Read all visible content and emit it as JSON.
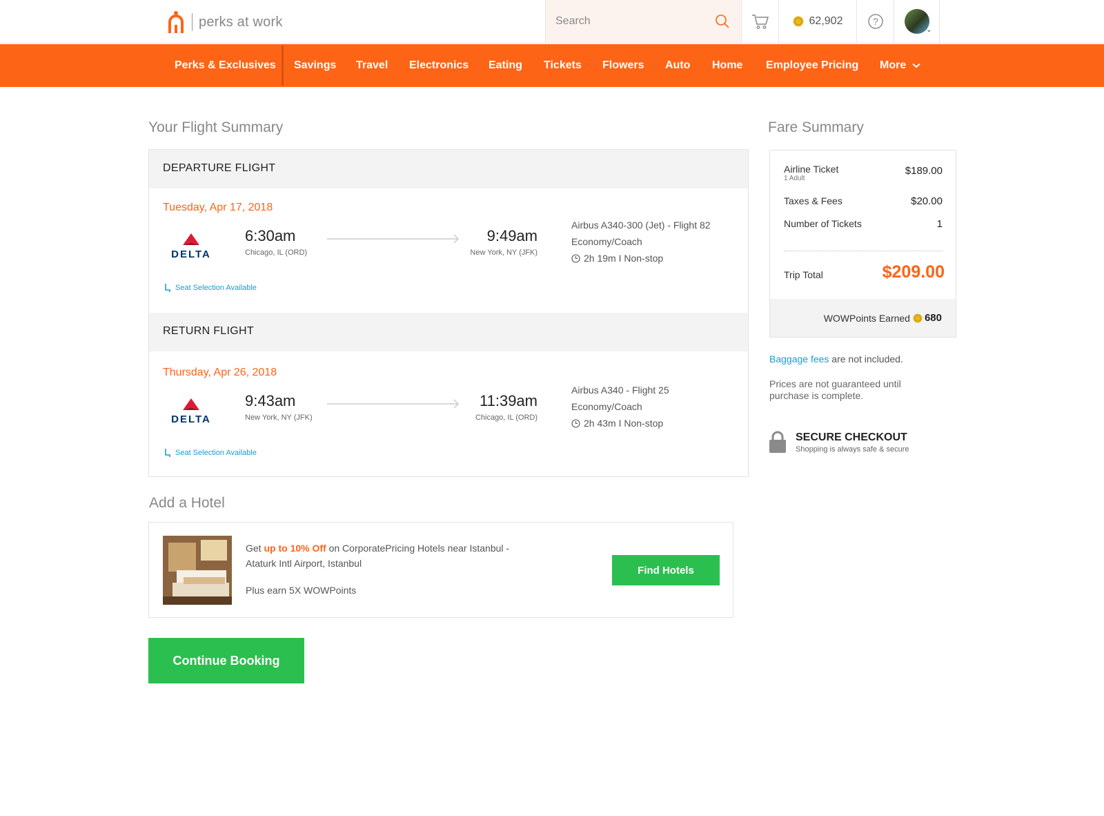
{
  "header": {
    "logo_text": "perks at work",
    "search_placeholder": "Search",
    "points": "62,902"
  },
  "nav": {
    "items": [
      "Perks & Exclusives",
      "Savings",
      "Travel",
      "Electronics",
      "Eating",
      "Tickets",
      "Flowers",
      "Auto",
      "Home",
      "Employee Pricing",
      "More"
    ]
  },
  "flight_summary": {
    "title": "Your Flight Summary",
    "departure": {
      "header": "DEPARTURE FLIGHT",
      "date": "Tuesday, Apr 17, 2018",
      "airline": "DELTA",
      "depart_time": "6:30am",
      "depart_city": "Chicago, IL (ORD)",
      "arrive_time": "9:49am",
      "arrive_city": "New York, NY (JFK)",
      "aircraft": "Airbus A340-300 (Jet) - Flight 82",
      "cabin": "Economy/Coach",
      "duration": "2h 19m  I  Non-stop",
      "seat": "Seat Selection Available"
    },
    "return": {
      "header": "RETURN FLIGHT",
      "date": "Thursday, Apr 26, 2018",
      "airline": "DELTA",
      "depart_time": "9:43am",
      "depart_city": "New York, NY (JFK)",
      "arrive_time": "11:39am",
      "arrive_city": "Chicago, IL (ORD)",
      "aircraft": "Airbus A340 - Flight 25",
      "cabin": "Economy/Coach",
      "duration": "2h 43m  I  Non-stop",
      "seat": "Seat Selection Available"
    }
  },
  "hotel": {
    "title": "Add a Hotel",
    "text_get": "Get ",
    "text_highlight": "up to 10% Off",
    "text_rest": " on CorporatePricing Hotels near Istanbul - Ataturk Intl Airport, Istanbul",
    "text_plus": "Plus earn 5X WOWPoints",
    "button": "Find Hotels"
  },
  "continue_button": "Continue Booking",
  "fare": {
    "title": "Fare Summary",
    "airline_ticket_label": "Airline Ticket",
    "airline_ticket_sub": "1 Adult",
    "airline_ticket_value": "$189.00",
    "taxes_label": "Taxes & Fees",
    "taxes_value": "$20.00",
    "tickets_label": "Number of Tickets",
    "tickets_value": "1",
    "total_label": "Trip Total",
    "total_value": "$209.00",
    "wow_label": "WOWPoints Earned",
    "wow_value": "680"
  },
  "notes": {
    "baggage_link": "Baggage fees",
    "baggage_rest": " are not included.",
    "guarantee": "Prices are not guaranteed until purchase is complete.",
    "secure_title": "SECURE CHECKOUT",
    "secure_sub": "Shopping is always safe & secure"
  },
  "colors": {
    "brand_orange": "#fe6416",
    "action_green": "#2bbf4f",
    "link_blue": "#1a9bd1"
  }
}
